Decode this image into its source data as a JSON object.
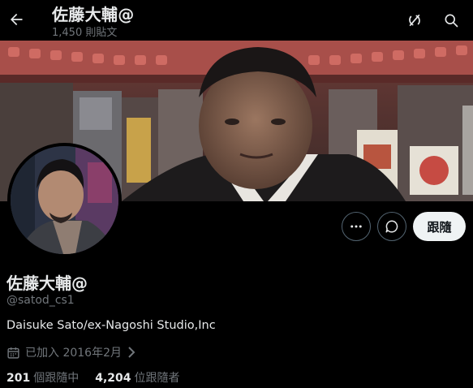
{
  "header": {
    "title": "佐藤大輔@",
    "post_count": "1,450 則貼文"
  },
  "profile": {
    "display_name": "佐藤大輔@",
    "handle": "@satod_cs1",
    "bio": "Daisuke Sato/ex-Nagoshi Studio,Inc",
    "joined": "已加入 2016年2月",
    "following_count": "201",
    "following_label": "個跟隨中",
    "followers_count": "4,204",
    "followers_label": "位跟隨者"
  },
  "actions": {
    "follow_label": "跟隨"
  },
  "icons": {
    "back": "arrow-left-icon",
    "grok": "grok-icon",
    "search": "search-icon",
    "more": "more-icon",
    "message": "message-icon",
    "calendar": "calendar-icon"
  },
  "colors": {
    "background": "#000000",
    "text_primary": "#e7e9ea",
    "text_secondary": "#71767b",
    "follow_button_bg": "#eff3f4"
  }
}
